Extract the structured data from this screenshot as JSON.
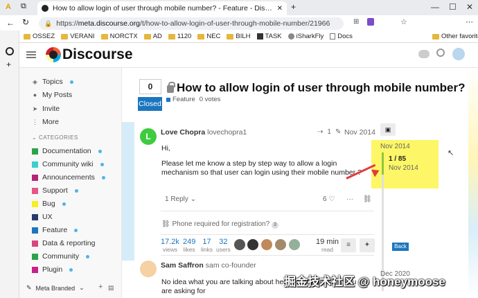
{
  "browser": {
    "tab_title": "How to allow login of user through mobile number? - Feature - Discourse Meta",
    "url_prefix": "https://",
    "url_domain": "meta.discourse.org",
    "url_path": "/t/how-to-allow-login-of-user-through-mobile-number/21966",
    "bookmarks": [
      "OSSEZ",
      "VERANI",
      "NORCTX",
      "AD",
      "1120",
      "NEC",
      "BILH",
      "TASK",
      "iSharkFly",
      "Docs"
    ],
    "other_favorites": "Other favorites"
  },
  "site": {
    "logo_text": "Discourse"
  },
  "sidebar": {
    "top_items": [
      {
        "label": "Topics",
        "icon": "layers-icon",
        "dot": true
      },
      {
        "label": "My Posts",
        "icon": "user-icon",
        "dot": false
      },
      {
        "label": "Invite",
        "icon": "send-icon",
        "dot": false
      },
      {
        "label": "More",
        "icon": "more-icon",
        "dot": false
      }
    ],
    "categories_header": "CATEGORIES",
    "categories": [
      {
        "label": "Documentation",
        "color": "#2aa34a",
        "dot": true
      },
      {
        "label": "Community wiki",
        "color": "#3ccfcf",
        "dot": true
      },
      {
        "label": "Announcements",
        "color": "#b3247a",
        "dot": true
      },
      {
        "label": "Support",
        "color": "#e45787",
        "dot": true
      },
      {
        "label": "Bug",
        "color": "#f7ef1f",
        "dot": true
      },
      {
        "label": "UX",
        "color": "#283b6a",
        "dot": false
      },
      {
        "label": "Feature",
        "color": "#1c75be",
        "dot": true
      },
      {
        "label": "Data & reporting",
        "color": "#d84680",
        "dot": false
      },
      {
        "label": "Community",
        "color": "#2aa34a",
        "dot": true
      },
      {
        "label": "Plugin",
        "color": "#c8208a",
        "dot": true
      }
    ],
    "footer": "Meta Branded"
  },
  "topic": {
    "vote_count": "0",
    "closed_label": "Closed",
    "title": "How to allow login of user through mobile number?",
    "category": "Feature",
    "votes": "0 votes"
  },
  "post1": {
    "avatar_letter": "L",
    "display_name": "Love Chopra",
    "username": "lovechopra1",
    "edits": "1",
    "date": "Nov 2014",
    "greeting": "Hi,",
    "body": "Please let me know a step by step way to allow a login mechanism so that user can login using their mobile number ?",
    "replies": "1 Reply",
    "likes": "6"
  },
  "related": {
    "text": "Phone required for registration?",
    "count": "3"
  },
  "stats": [
    {
      "value": "17.2k",
      "label": "views"
    },
    {
      "value": "249",
      "label": "likes"
    },
    {
      "value": "17",
      "label": "links"
    },
    {
      "value": "32",
      "label": "users"
    }
  ],
  "last_reply": {
    "value": "19 min",
    "label": "read"
  },
  "post2": {
    "display_name": "Sam Saffron",
    "username": "sam",
    "title": "co-founder",
    "body": "No idea what you are talking about here but my guess is you are asking for"
  },
  "timeline": {
    "top_date": "Nov 2014",
    "progress": "1 / 85",
    "current_date": "Nov 2014",
    "back_label": "Back",
    "bottom_date": "Dec 2020"
  },
  "watermark": "掘金技术社区 @ honeymoose"
}
